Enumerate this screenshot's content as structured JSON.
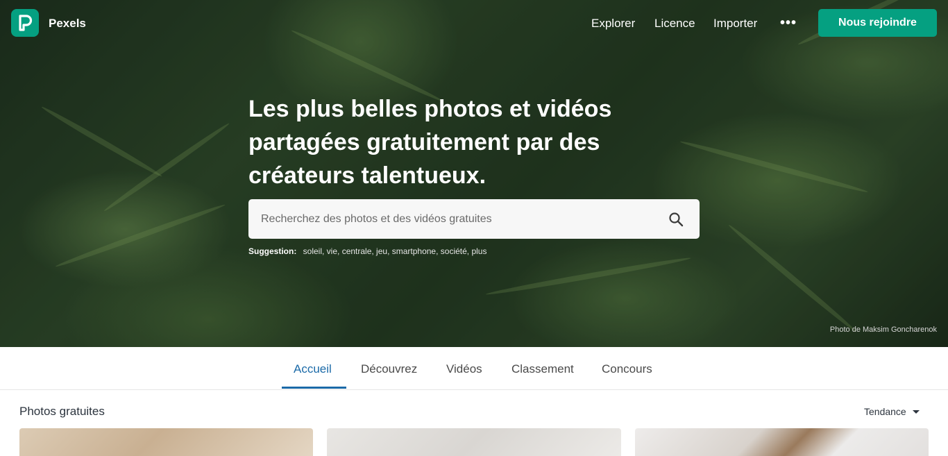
{
  "brand": {
    "name": "Pexels",
    "accent": "#05a081",
    "logo_letter": "P"
  },
  "nav": {
    "links": [
      "Explorer",
      "Licence",
      "Importer"
    ],
    "more": "•••",
    "join_label": "Nous rejoindre"
  },
  "hero": {
    "headline": "Les plus belles photos et vidéos partagées gratuitement par des créateurs talentueux.",
    "search_placeholder": "Recherchez des photos et des vidéos gratuites",
    "suggestion_label": "Suggestion:",
    "suggestions": "soleil, vie, centrale, jeu, smartphone, société, plus",
    "credit": "Photo de Maksim Goncharenok"
  },
  "tabs": {
    "items": [
      "Accueil",
      "Découvrez",
      "Vidéos",
      "Classement",
      "Concours"
    ],
    "active": "Accueil",
    "active_color": "#1b6aa8"
  },
  "section": {
    "title": "Photos gratuites",
    "sort_label": "Tendance"
  }
}
